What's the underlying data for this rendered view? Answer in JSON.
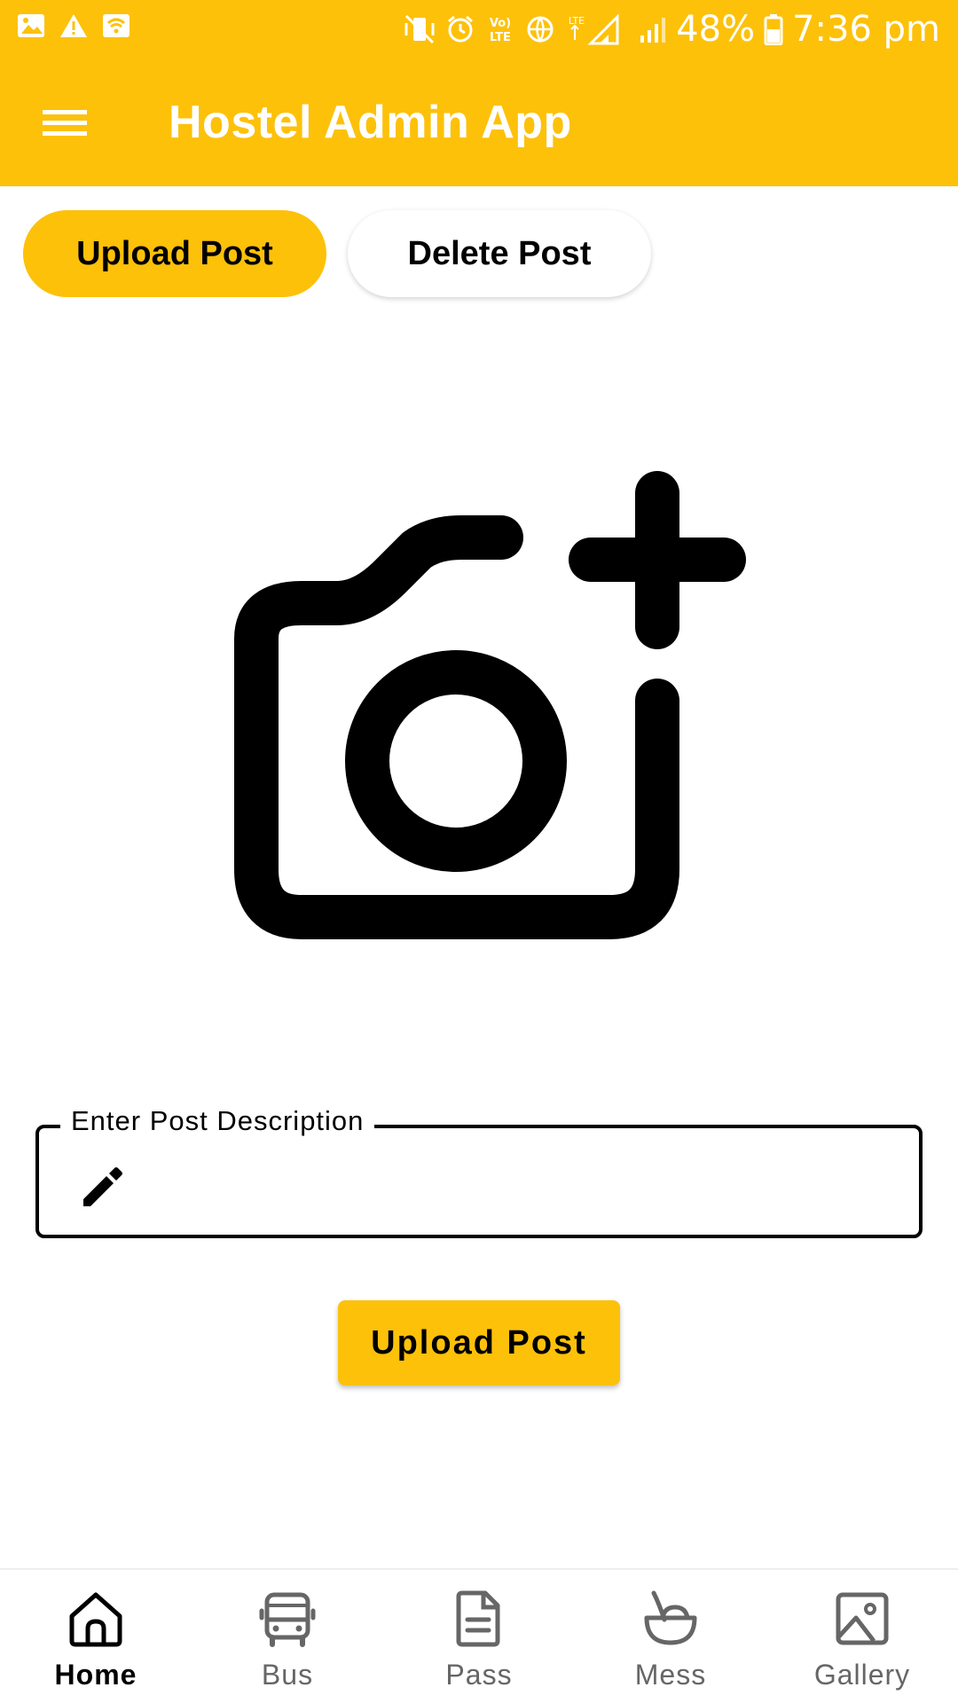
{
  "status_bar": {
    "battery": "48%",
    "time": "7:36 pm"
  },
  "app_bar": {
    "title": "Hostel Admin App",
    "menu_icon": "hamburger-menu-icon"
  },
  "tabs": [
    {
      "label": "Upload Post",
      "active": true
    },
    {
      "label": "Delete Post",
      "active": false
    }
  ],
  "image_picker": {
    "icon": "add-photo-camera-icon"
  },
  "description_field": {
    "label": "Enter Post Description",
    "value": "",
    "icon": "pencil-icon"
  },
  "upload_button": {
    "label": "Upload Post"
  },
  "bottom_nav": [
    {
      "label": "Home",
      "icon": "home-icon",
      "active": true
    },
    {
      "label": "Bus",
      "icon": "bus-icon",
      "active": false
    },
    {
      "label": "Pass",
      "icon": "document-icon",
      "active": false
    },
    {
      "label": "Mess",
      "icon": "food-bowl-icon",
      "active": false
    },
    {
      "label": "Gallery",
      "icon": "image-icon",
      "active": false
    }
  ],
  "colors": {
    "accent": "#FDC10A",
    "active_nav": "#000000",
    "inactive_nav": "#666666"
  }
}
